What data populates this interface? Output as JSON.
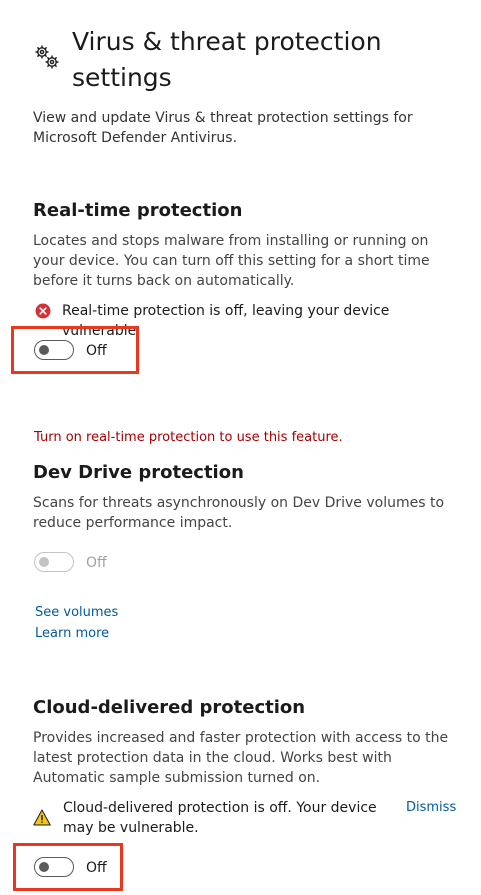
{
  "header": {
    "title": "Virus & threat protection settings",
    "description": "View and update Virus & threat protection settings for Microsoft Defender Antivirus.",
    "icon": "gears-icon"
  },
  "realtime": {
    "title": "Real-time protection",
    "description": "Locates and stops malware from installing or running on your device. You can turn off this setting for a short time before it turns back on automatically.",
    "status": "Real-time protection is off, leaving your device vulnerable.",
    "status_icon": "error-icon",
    "toggle_label": "Off"
  },
  "devdrive": {
    "error": "Turn on real-time protection to use this feature.",
    "title": "Dev Drive protection",
    "description": "Scans for threats asynchronously on Dev Drive volumes to reduce performance impact.",
    "toggle_label": "Off",
    "link_volumes": "See volumes",
    "link_learn": "Learn more"
  },
  "cloud": {
    "title": "Cloud-delivered protection",
    "description": "Provides increased and faster protection with access to the latest protection data in the cloud. Works best with Automatic sample submission turned on.",
    "status": "Cloud-delivered protection is off. Your device may be vulnerable.",
    "status_icon": "warning-icon",
    "dismiss": "Dismiss",
    "toggle_label": "Off"
  },
  "colors": {
    "error": "#d13438",
    "warning": "#f5c518",
    "link": "#005a9e",
    "highlight": "#e8381f"
  }
}
